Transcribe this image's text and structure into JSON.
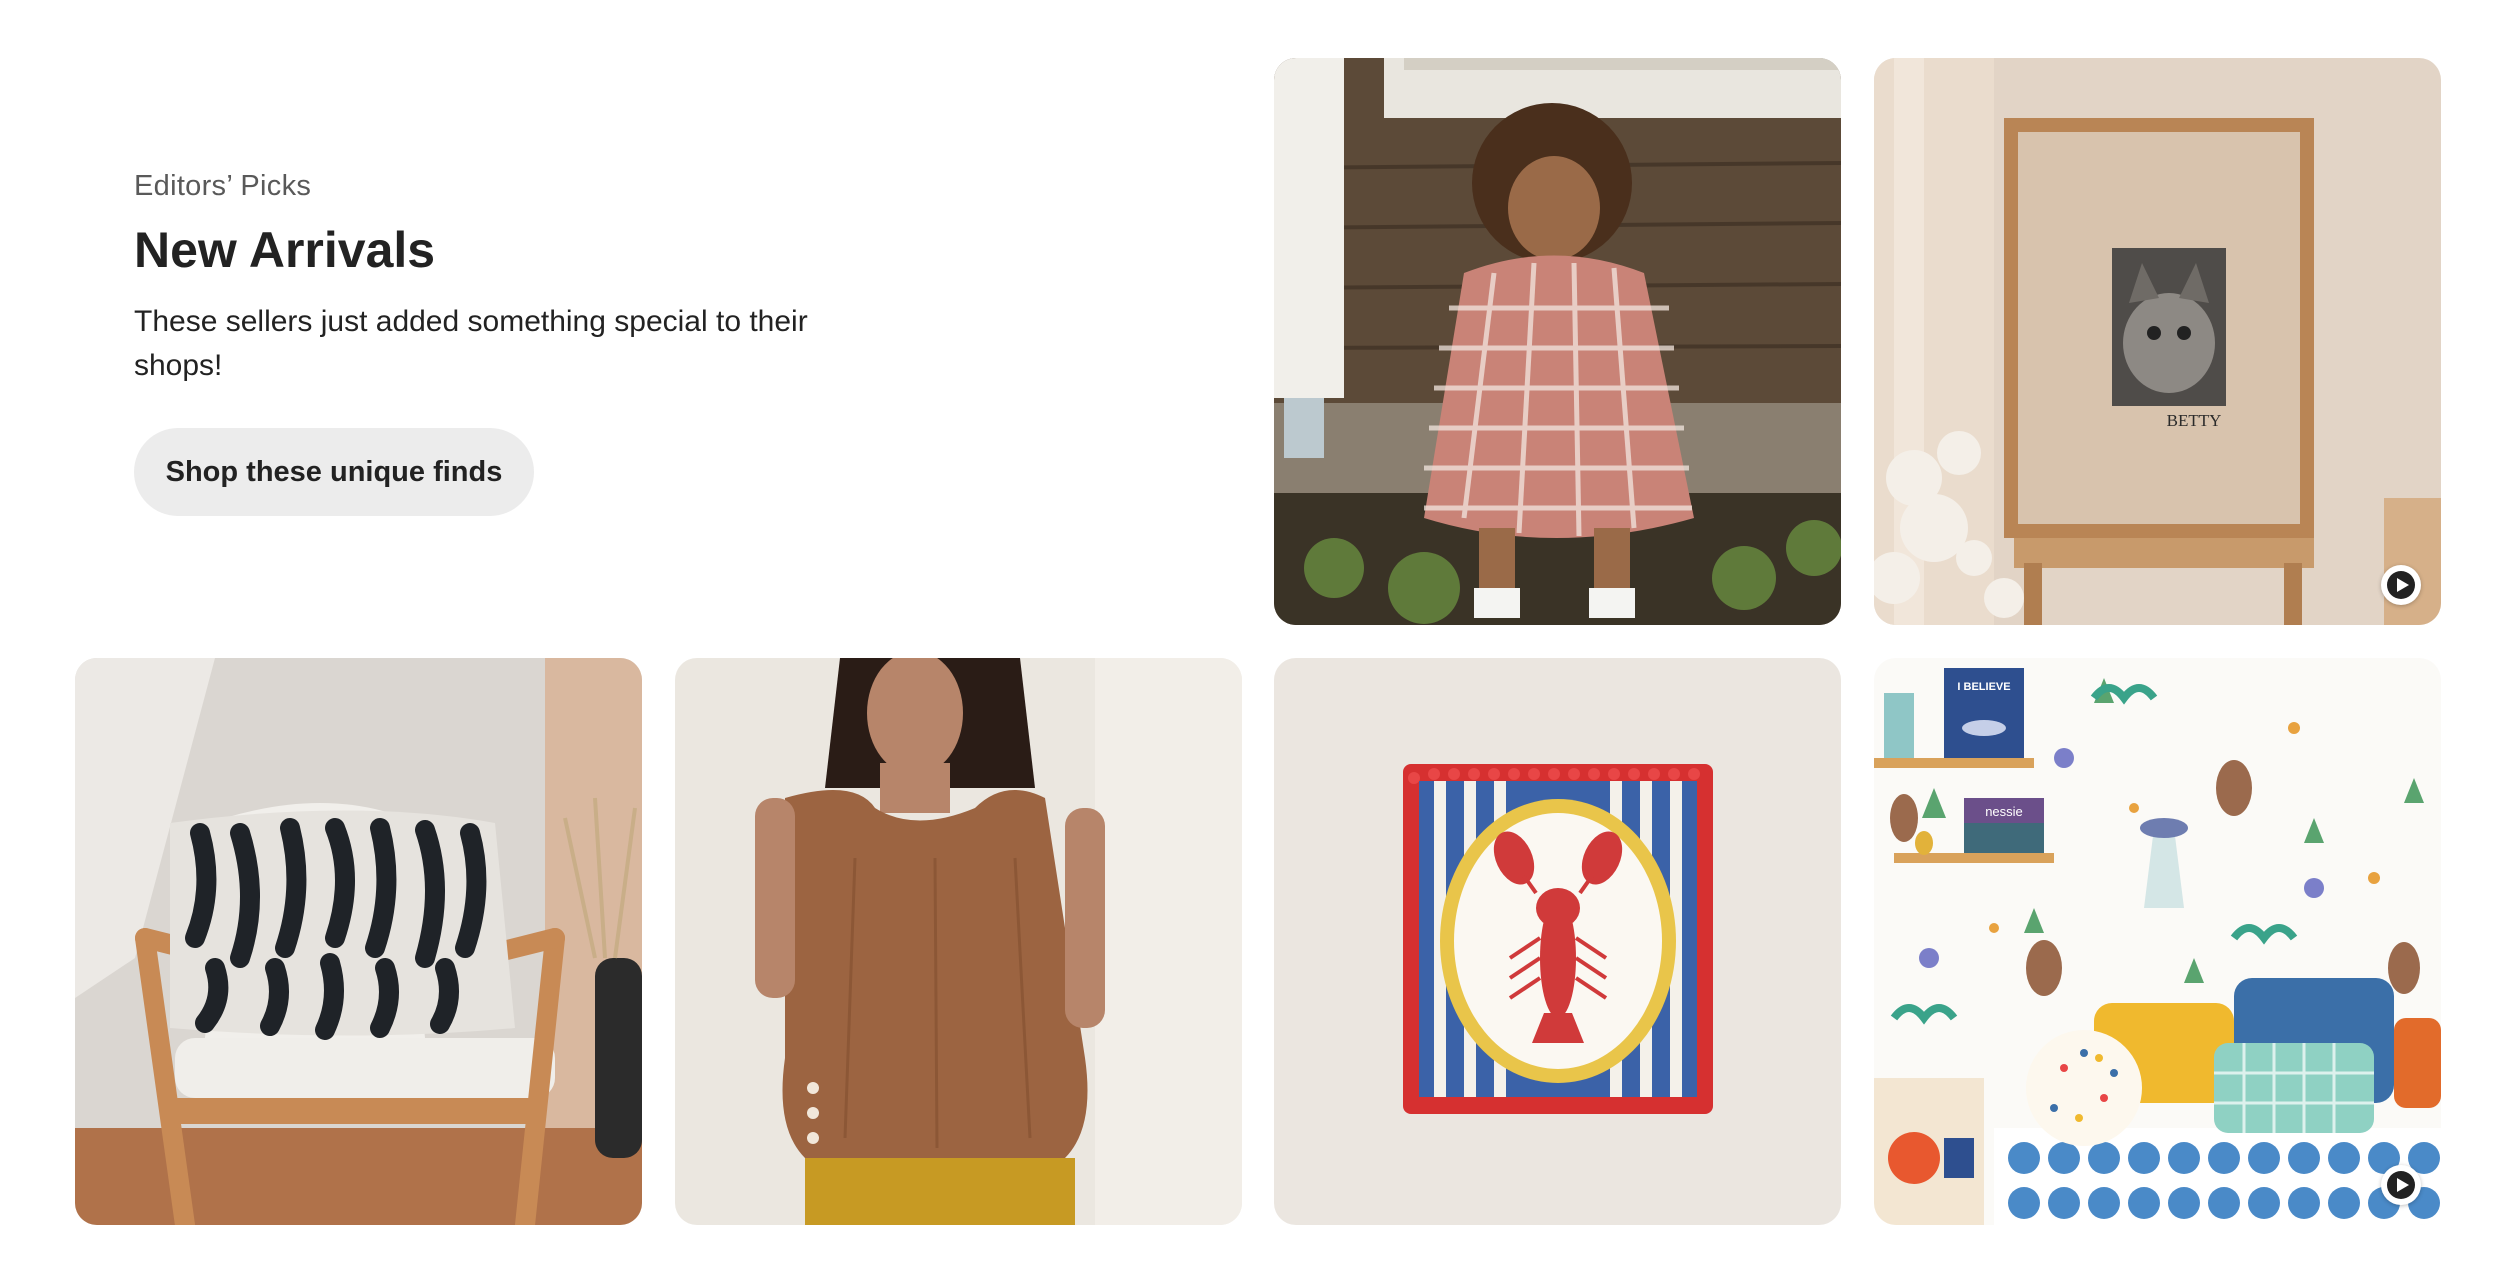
{
  "section": {
    "eyebrow": "Editors’ Picks",
    "title": "New Arrivals",
    "description": "These sellers just added something special to their shops!",
    "cta_label": "Shop these unique finds"
  },
  "tiles": [
    {
      "name": "child-gingham-dress",
      "has_video": false
    },
    {
      "name": "cat-portrait-print",
      "has_video": true,
      "print_caption": "BETTY"
    },
    {
      "name": "zebra-pillow-chair",
      "has_video": false
    },
    {
      "name": "linen-tank-top",
      "has_video": false
    },
    {
      "name": "lobster-art-print",
      "has_video": false
    },
    {
      "name": "kids-wallpaper",
      "has_video": true,
      "book_titles": [
        "I BELIEVE",
        "nessie"
      ]
    }
  ],
  "colors": {
    "button_bg": "#ececec",
    "text_primary": "#222222",
    "text_secondary": "#595959"
  },
  "icons": [
    "play-icon"
  ]
}
